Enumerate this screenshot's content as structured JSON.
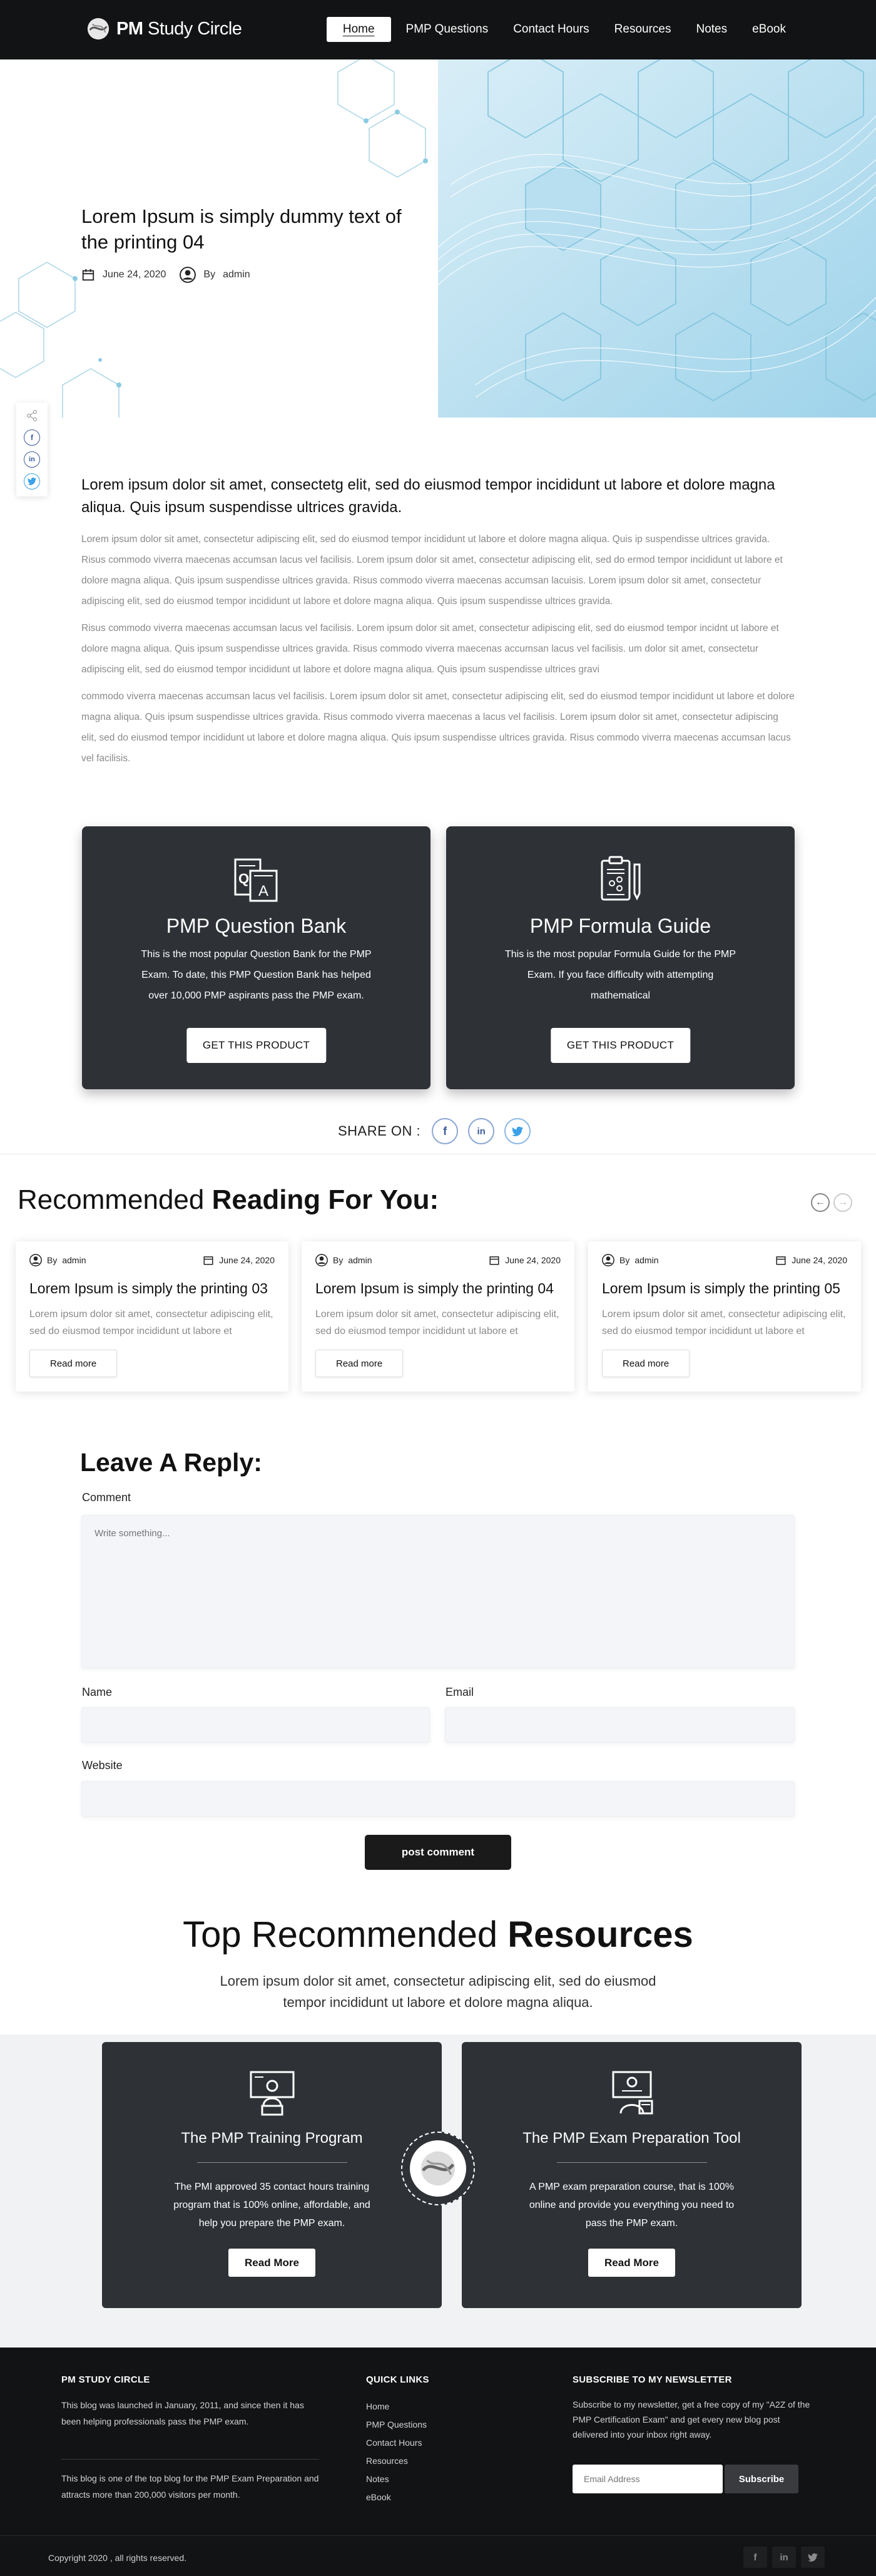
{
  "nav": {
    "logo_text_bold": "PM",
    "logo_text_rest": " Study Circle",
    "items": [
      {
        "label": "Home",
        "active": true
      },
      {
        "label": "PMP Questions"
      },
      {
        "label": "Contact Hours"
      },
      {
        "label": "Resources"
      },
      {
        "label": "Notes"
      },
      {
        "label": "eBook"
      }
    ]
  },
  "hero": {
    "title": "Lorem Ipsum is simply dummy text of the printing 04",
    "date": "June 24, 2020",
    "author_prefix": "By",
    "author": "admin"
  },
  "share_rail": [
    "share-icon",
    "facebook-icon",
    "linkedin-icon",
    "twitter-icon"
  ],
  "article": {
    "lead": "Lorem ipsum dolor sit amet, consectetg elit, sed do eiusmod tempor incididunt ut labore et dolore magna aliqua. Quis ipsum suspendisse ultrices gravida.",
    "paragraphs": [
      "Lorem ipsum dolor sit amet, consectetur adipiscing elit, sed do eiusmod tempor incididunt ut labore et dolore magna aliqua. Quis ip suspendisse ultrices gravida. Risus commodo viverra maecenas accumsan lacus vel facilisis. Lorem ipsum dolor sit amet, consectetur adipiscing elit, sed do ermod tempor incididunt ut labore et dolore magna aliqua. Quis ipsum suspendisse ultrices gravida. Risus commodo viverra maecenas accumsan lacuisis. Lorem ipsum dolor sit amet, consectetur adipiscing elit, sed do eiusmod tempor incididunt ut labore et dolore magna aliqua. Quis ipsum suspendisse ultrices gravida.",
      "Risus commodo viverra maecenas accumsan lacus vel facilisis. Lorem ipsum dolor sit amet, consectetur adipiscing elit, sed do eiusmod tempor incidnt ut labore et dolore magna aliqua. Quis ipsum suspendisse ultrices gravida. Risus commodo viverra maecenas accumsan lacus vel facilisis. um dolor sit amet, consectetur adipiscing elit, sed do eiusmod tempor incididunt ut labore et dolore magna aliqua. Quis ipsum suspendisse ultrices gravi",
      "commodo viverra maecenas accumsan lacus vel facilisis. Lorem ipsum dolor sit amet, consectetur adipiscing elit, sed do eiusmod tempor incididunt ut labore et dolore magna aliqua. Quis ipsum suspendisse ultrices gravida. Risus commodo viverra maecenas a lacus vel facilisis. Lorem ipsum dolor sit amet, consectetur adipiscing elit, sed do eiusmod tempor incididunt ut labore et dolore magna aliqua. Quis ipsum suspendisse ultrices gravida. Risus commodo viverra maecenas accumsan lacus vel facilisis."
    ]
  },
  "products": [
    {
      "icon": "question-bank-icon",
      "title": "PMP Question Bank",
      "desc": "This is the most popular Question Bank for the PMP Exam. To date, this PMP Question Bank has helped over 10,000 PMP aspirants pass the PMP exam.",
      "button": "GET THIS PRODUCT"
    },
    {
      "icon": "formula-guide-icon",
      "title": "PMP Formula Guide",
      "desc": "This is the most popular Formula Guide for the PMP Exam. If you face difficulty with attempting mathematical",
      "button": "GET THIS PRODUCT"
    }
  ],
  "share_on": {
    "label": "SHARE ON :",
    "fb": "f",
    "in": "in",
    "tw": "t"
  },
  "recommended": {
    "title_light": "Recommended ",
    "title_bold": "Reading For You:",
    "cards": [
      {
        "author_prefix": "By",
        "author": "admin",
        "date": "June 24, 2020",
        "title": "Lorem Ipsum is simply the printing 03",
        "excerpt": "Lorem ipsum dolor sit amet, consectetur adipiscing elit, sed do eiusmod tempor incididunt ut labore et",
        "button": "Read more"
      },
      {
        "author_prefix": "By",
        "author": "admin",
        "date": "June 24, 2020",
        "title": "Lorem Ipsum is simply the printing 04",
        "excerpt": "Lorem ipsum dolor sit amet, consectetur adipiscing elit, sed do eiusmod tempor incididunt ut labore et",
        "button": "Read more"
      },
      {
        "author_prefix": "By",
        "author": "admin",
        "date": "June 24, 2020",
        "title": "Lorem Ipsum is simply the printing 05",
        "excerpt": "Lorem ipsum dolor sit amet, consectetur adipiscing elit, sed do eiusmod tempor incididunt ut labore et",
        "button": "Read more"
      }
    ]
  },
  "reply": {
    "title": "Leave A Reply:",
    "comment_label": "Comment",
    "comment_placeholder": "Write something...",
    "name_label": "Name",
    "email_label": "Email",
    "website_label": "Website",
    "submit": "post comment"
  },
  "top_resources": {
    "title_light": "Top Recommended ",
    "title_bold": "Resources",
    "subtitle": "Lorem ipsum dolor sit amet, consectetur adipiscing elit, sed do eiusmod tempor incididunt ut labore et dolore magna aliqua.",
    "cards": [
      {
        "icon": "training-program-icon",
        "title": "The PMP Training Program",
        "desc": "The PMI approved 35 contact hours training program that is 100% online, affordable, and help you prepare the PMP exam.",
        "button": "Read More"
      },
      {
        "icon": "exam-prep-tool-icon",
        "title": "The PMP Exam Preparation Tool",
        "desc": "A PMP exam preparation course, that is 100% online and provide you everything you need to pass the PMP exam.",
        "button": "Read More"
      }
    ]
  },
  "footer": {
    "about_heading": "PM STUDY CIRCLE",
    "about_text": "This blog was launched in January, 2011, and since then it has been helping professionals pass the PMP exam.",
    "about_text2": "This blog is one of the top blog for the PMP Exam Preparation and attracts more than 200,000 visitors per month.",
    "links_heading": "QUICK LINKS",
    "links": [
      "Home",
      "PMP Questions",
      "Contact Hours",
      "Resources",
      "Notes",
      "eBook"
    ],
    "newsletter_heading": "SUBSCRIBE TO MY NEWSLETTER",
    "newsletter_text": "Subscribe to my newsletter, get a free copy of my \"A2Z of the PMP Certification Exam\" and get every new blog post delivered into your inbox right away.",
    "email_placeholder": "Email Address",
    "subscribe": "Subscribe",
    "copyright": "Copyright 2020 , all rights reserved.",
    "social": {
      "fb": "f",
      "in": "in",
      "tw": "t"
    }
  }
}
